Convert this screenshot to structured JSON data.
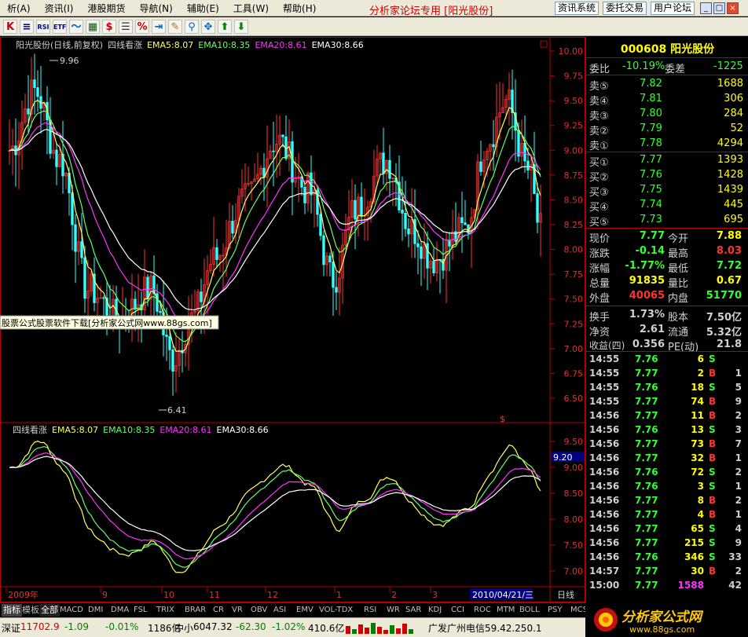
{
  "menu": [
    "析(A)",
    "资讯(I)",
    "港股期货",
    "导航(N)",
    "辅助(E)",
    "工具(W)",
    "帮助(H)"
  ],
  "brand": "分析家论坛专用 [阳光股份]",
  "top_buttons": [
    "资讯系统",
    "委托交易",
    "用户论坛"
  ],
  "window_buttons": [
    "_",
    "□",
    "×"
  ],
  "toolbar_icons": [
    "chart-icon",
    "bar-chart-icon",
    "rsi-icon",
    "etf-icon",
    "wave-icon",
    "grid-icon",
    "dollar-icon",
    "list-icon",
    "percent-icon",
    "enter-icon",
    "pencil-icon",
    "zoom-icon",
    "pan-icon",
    "up-arrow-icon",
    "down-arrow-icon"
  ],
  "toolbar_icon_text": [
    "K",
    "≡",
    "RSI",
    "ETF",
    "〜",
    "▦",
    "$",
    "☰",
    "%",
    "⇥",
    "✎",
    "⚲",
    "✥",
    "⬆",
    "⬇"
  ],
  "main_chart": {
    "header_stock": "阳光股份(日线,前复权)",
    "indicator": "四线看涨",
    "ema5": "EMA5:8.07",
    "ema10": "EMA10:8.35",
    "ema20": "EMA20:8.61",
    "ema30": "EMA30:8.66",
    "yaxis": [
      "10.00",
      "9.75",
      "9.50",
      "9.25",
      "9.00",
      "8.75",
      "8.50",
      "8.25",
      "8.00",
      "7.75",
      "7.50",
      "7.25",
      "7.00",
      "6.75",
      "6.50"
    ],
    "high_marker": "9.96",
    "low_marker": "6.41",
    "ad_text": "股票公式股票软件下载[分析家公式网www.88gs.com]",
    "s_marker": "$"
  },
  "sub_chart": {
    "indicator": "四线看涨",
    "ema5": "EMA5:8.07",
    "ema10": "EMA10:8.35",
    "ema20": "EMA20:8.61",
    "ema30": "EMA30:8.66",
    "yaxis": [
      "9.50",
      "9.00",
      "8.50",
      "8.00",
      "7.50",
      "7.00"
    ],
    "cursor_value": "9.20"
  },
  "time_axis": {
    "labels": [
      "2009年",
      "9",
      "10",
      "11",
      "12",
      "1",
      "2",
      "3"
    ],
    "current": "2010/04/21/三",
    "period": "日线"
  },
  "colors": {
    "ema5": "#ffff66",
    "ema10": "#66ff66",
    "ema20": "#ff33ff",
    "ema30": "#ffffff",
    "up": "#ff3333",
    "down": "#33ffff",
    "accent": "#b40000"
  },
  "quote": {
    "title": "000608 阳光股份",
    "wei": {
      "label1": "委比",
      "v1": "-10.19%",
      "label2": "委差",
      "v2": "-1225"
    },
    "sell": [
      {
        "l": "卖⑤",
        "p": "7.82",
        "v": "1688"
      },
      {
        "l": "卖④",
        "p": "7.81",
        "v": "306"
      },
      {
        "l": "卖③",
        "p": "7.80",
        "v": "284"
      },
      {
        "l": "卖②",
        "p": "7.79",
        "v": "52"
      },
      {
        "l": "卖①",
        "p": "7.78",
        "v": "4294"
      }
    ],
    "buy": [
      {
        "l": "买①",
        "p": "7.77",
        "v": "1393"
      },
      {
        "l": "买②",
        "p": "7.76",
        "v": "1428"
      },
      {
        "l": "买③",
        "p": "7.75",
        "v": "1439"
      },
      {
        "l": "买④",
        "p": "7.74",
        "v": "445"
      },
      {
        "l": "买⑤",
        "p": "7.73",
        "v": "695"
      }
    ],
    "stats": [
      {
        "l1": "现价",
        "v1": "7.77",
        "l2": "今开",
        "v2": "7.88"
      },
      {
        "l1": "涨跌",
        "v1": "-0.14",
        "l2": "最高",
        "v2": "8.03"
      },
      {
        "l1": "涨幅",
        "v1": "-1.77%",
        "l2": "最低",
        "v2": "7.72"
      },
      {
        "l1": "总量",
        "v1": "91835",
        "l2": "量比",
        "v2": "0.67"
      },
      {
        "l1": "外盘",
        "v1": "40065",
        "l2": "内盘",
        "v2": "51770"
      },
      {
        "l1": "换手",
        "v1": "1.73%",
        "l2": "股本",
        "v2": "7.50亿"
      },
      {
        "l1": "净资",
        "v1": "2.61",
        "l2": "流通",
        "v2": "5.32亿"
      },
      {
        "l1": "收益(四)",
        "v1": "0.356",
        "l2": "PE(动)",
        "v2": "21.8"
      }
    ],
    "ticks": [
      {
        "t": "14:55",
        "p": "7.76",
        "v": "6",
        "d": "S",
        "n": ""
      },
      {
        "t": "14:55",
        "p": "7.77",
        "v": "2",
        "d": "B",
        "n": "1"
      },
      {
        "t": "14:55",
        "p": "7.76",
        "v": "18",
        "d": "S",
        "n": "5"
      },
      {
        "t": "14:55",
        "p": "7.77",
        "v": "74",
        "d": "B",
        "n": "9"
      },
      {
        "t": "14:56",
        "p": "7.77",
        "v": "11",
        "d": "B",
        "n": "2"
      },
      {
        "t": "14:56",
        "p": "7.76",
        "v": "13",
        "d": "S",
        "n": "3"
      },
      {
        "t": "14:56",
        "p": "7.77",
        "v": "73",
        "d": "B",
        "n": "7"
      },
      {
        "t": "14:56",
        "p": "7.77",
        "v": "32",
        "d": "B",
        "n": "1"
      },
      {
        "t": "14:56",
        "p": "7.76",
        "v": "72",
        "d": "S",
        "n": "2"
      },
      {
        "t": "14:56",
        "p": "7.76",
        "v": "3",
        "d": "S",
        "n": "1"
      },
      {
        "t": "14:56",
        "p": "7.77",
        "v": "8",
        "d": "B",
        "n": "2"
      },
      {
        "t": "14:56",
        "p": "7.77",
        "v": "4",
        "d": "B",
        "n": "1"
      },
      {
        "t": "14:56",
        "p": "7.77",
        "v": "65",
        "d": "S",
        "n": "4"
      },
      {
        "t": "14:56",
        "p": "7.77",
        "v": "215",
        "d": "S",
        "n": "9"
      },
      {
        "t": "14:56",
        "p": "7.76",
        "v": "346",
        "d": "S",
        "n": "33"
      },
      {
        "t": "14:57",
        "p": "7.77",
        "v": "30",
        "d": "B",
        "n": "2"
      },
      {
        "t": "15:00",
        "p": "7.77",
        "v": "1588",
        "d": "",
        "n": "42"
      }
    ]
  },
  "tabs": [
    "指标",
    "模板",
    "全部",
    "MACD",
    "DMI",
    "DMA",
    "FSL",
    "TRIX",
    "BRAR",
    "CR",
    "VR",
    "OBV",
    "ASI",
    "EMV",
    "VOL-TDX",
    "RSI",
    "WR",
    "SAR",
    "KDJ",
    "CCI",
    "ROC",
    "MTM",
    "BOLL",
    "PSY",
    "MCST"
  ],
  "status": {
    "sz_label": "深证",
    "sz_value": "11702.9",
    "sz_chg": "-1.09",
    "sz_pct": "-0.01%",
    "sz_amt": "1186亿",
    "zx_label": "中小",
    "zx_value": "6047.32",
    "zx_chg": "-62.30",
    "zx_pct": "-1.02%",
    "zx_amt": "410.6亿",
    "server": "广发广州电信59.42.250.1"
  },
  "logo": {
    "text": "分析家公式网",
    "url": "www.88gs.com"
  }
}
